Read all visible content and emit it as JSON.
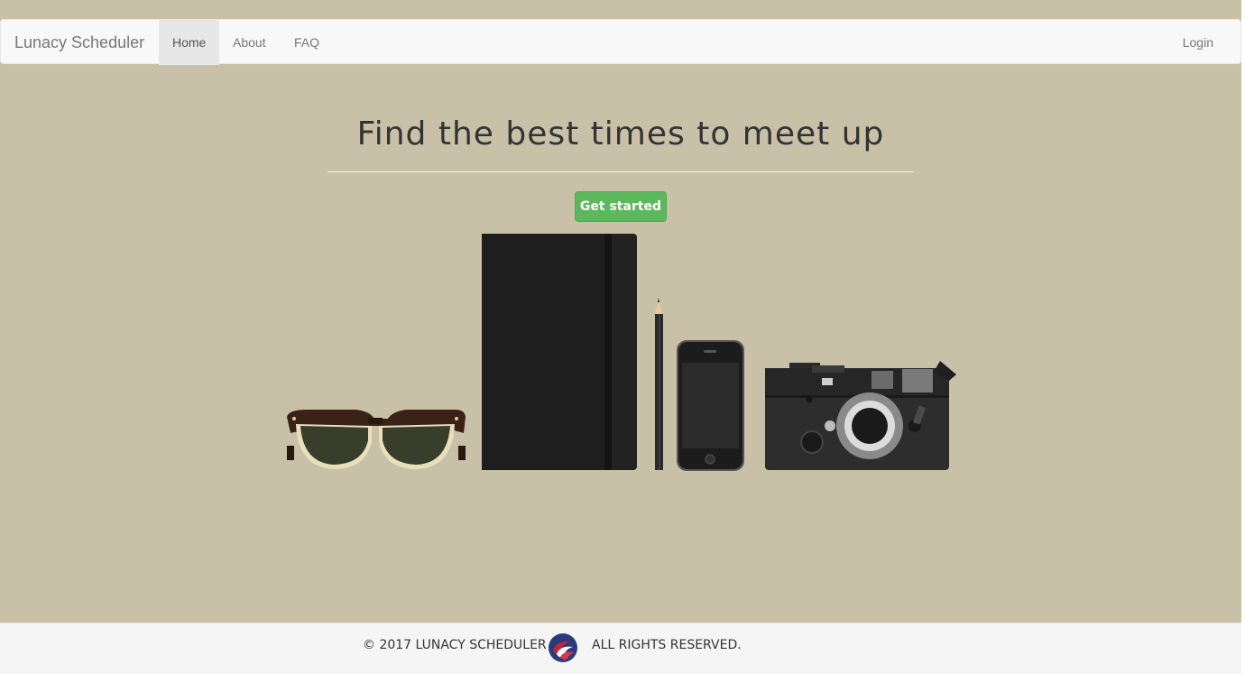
{
  "navbar": {
    "brand": "Lunacy Scheduler",
    "items": [
      {
        "label": "Home",
        "active": true
      },
      {
        "label": "About",
        "active": false
      },
      {
        "label": "FAQ",
        "active": false
      }
    ],
    "login_label": "Login"
  },
  "hero": {
    "title": "Find the best times to meet up",
    "cta_label": "Get started"
  },
  "illustration": {
    "items": [
      "sunglasses",
      "notebook",
      "pencil",
      "phone",
      "camera"
    ]
  },
  "footer": {
    "copyright": "© 2017 LUNACY SCHEDULER",
    "rights": "ALL RIGHTS RESERVED."
  },
  "colors": {
    "background": "#c8c1a8",
    "navbar": "#f8f8f8",
    "accent_green": "#5cb85c",
    "footer": "#f5f5f5"
  }
}
